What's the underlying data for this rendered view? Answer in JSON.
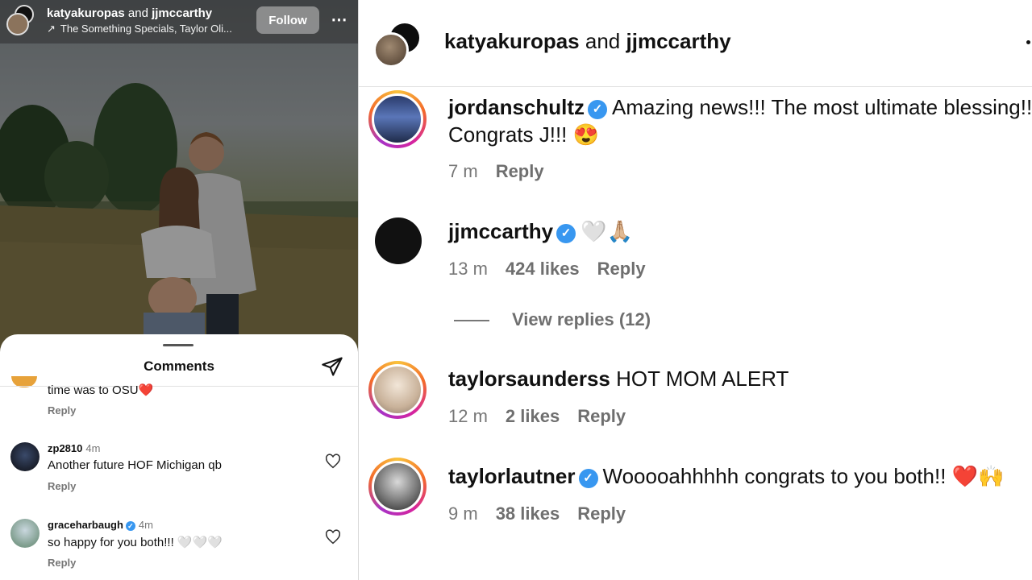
{
  "post": {
    "title_user_a": "katyakuropas",
    "title_and": "and",
    "title_user_b": "jjmccarthy",
    "subtitle": "The Something Specials, Taylor Oli...",
    "follow_label": "Follow",
    "more_label": "⋯"
  },
  "comments_sheet": {
    "title": "Comments",
    "partial_text": "time was to OSU❤️",
    "partial_reply": "Reply",
    "items": [
      {
        "user": "zp2810",
        "time": "4m",
        "text": "Another future HOF Michigan qb",
        "reply": "Reply",
        "verified": false
      },
      {
        "user": "graceharbaugh",
        "time": "4m",
        "text": "so happy for you both!!! 🤍🤍🤍",
        "reply": "Reply",
        "verified": true
      }
    ]
  },
  "zoom_panel": {
    "header": {
      "user_a": "katyakuropas",
      "and": "and",
      "user_b": "jjmccarthy"
    },
    "comments": [
      {
        "user": "jordanschultz",
        "verified": true,
        "text_line1": "Amazing news!!! The most ultimate blessing!!!",
        "text_line2": "Congrats J!!! 😍",
        "time": "7 m",
        "likes": "",
        "reply": "Reply"
      },
      {
        "user": "jjmccarthy",
        "verified": true,
        "text_line1": "🤍🙏🏼",
        "time": "13 m",
        "likes": "424 likes",
        "reply": "Reply"
      },
      {
        "user": "taylorsaunderss",
        "verified": false,
        "text_line1": "HOT MOM ALERT",
        "time": "12 m",
        "likes": "2 likes",
        "reply": "Reply"
      },
      {
        "user": "taylorlautner",
        "verified": true,
        "text_line1": "Wooooahhhhh congrats to you both!! ❤️🙌",
        "time": "9 m",
        "likes": "38 likes",
        "reply": "Reply"
      }
    ],
    "view_replies": "View replies (12)"
  },
  "colors": {
    "verified": "#3897f0",
    "ring_start": "#f9c23c",
    "ring_mid": "#d6249f"
  }
}
